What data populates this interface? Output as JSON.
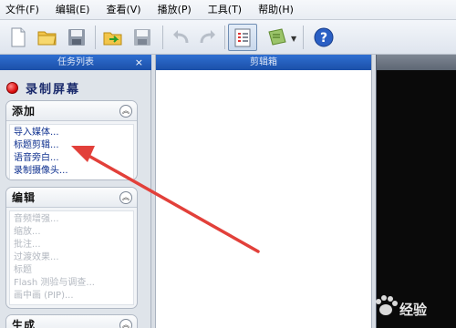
{
  "menu": [
    "文件(F)",
    "编辑(E)",
    "查看(V)",
    "播放(P)",
    "工具(T)",
    "帮助(H)"
  ],
  "task_panel": {
    "title": "任务列表",
    "close": "×",
    "record_label": "录制屏幕",
    "groups": [
      {
        "title": "添加",
        "items": [
          "导入媒体...",
          "标题剪辑...",
          "语音旁白...",
          "录制摄像头..."
        ],
        "enabled": true
      },
      {
        "title": "编辑",
        "items": [
          "音频增强...",
          "缩放...",
          "批注...",
          "过渡效果...",
          "标题",
          "Flash 测验与调查...",
          "画中画 (PIP)..."
        ],
        "enabled": false
      },
      {
        "title": "生成",
        "items": [],
        "enabled": true
      }
    ]
  },
  "storyboard": {
    "title": "剪辑箱"
  },
  "annotation_color": "#e2403a",
  "watermark": "经验"
}
